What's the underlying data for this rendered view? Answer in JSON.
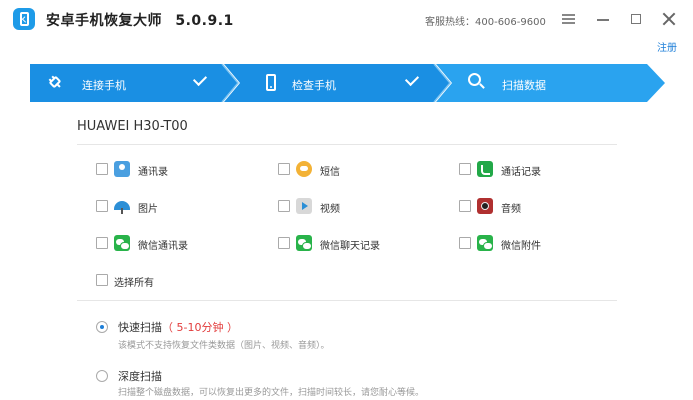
{
  "window": {
    "app_name": "安卓手机恢复大师",
    "version": "5.0.9.1",
    "hotline": "客服热线：400-606-9600",
    "register_link": "注册"
  },
  "steps": [
    {
      "label": "连接手机",
      "icon": "plug-icon",
      "done": true
    },
    {
      "label": "检查手机",
      "icon": "phone-icon",
      "done": true
    },
    {
      "label": "扫描数据",
      "icon": "search-icon",
      "done": false
    }
  ],
  "colors": {
    "step_dark": "#1a8fe3",
    "step_light": "#2aa3ef",
    "accent": "#1e7fd8",
    "highlight": "#e23b3b"
  },
  "device": {
    "name": "HUAWEI H30-T00"
  },
  "categories": [
    {
      "label": "通讯录",
      "icon": "contacts-icon"
    },
    {
      "label": "短信",
      "icon": "sms-icon"
    },
    {
      "label": "通话记录",
      "icon": "call-log-icon"
    },
    {
      "label": "图片",
      "icon": "photo-icon"
    },
    {
      "label": "视频",
      "icon": "video-icon"
    },
    {
      "label": "音频",
      "icon": "audio-icon"
    },
    {
      "label": "微信通讯录",
      "icon": "wechat-icon"
    },
    {
      "label": "微信聊天记录",
      "icon": "wechat-icon"
    },
    {
      "label": "微信附件",
      "icon": "wechat-icon"
    }
  ],
  "select_all_label": "选择所有",
  "scan_modes": [
    {
      "title": "快速扫描",
      "duration": "（ 5-10分钟 ）",
      "desc": "该模式不支持恢复文件类数据（图片、视频、音频）。",
      "selected": true
    },
    {
      "title": "深度扫描",
      "duration": "",
      "desc": "扫描整个磁盘数据，可以恢复出更多的文件，扫描时间较长，请您耐心等候。",
      "selected": false
    }
  ]
}
